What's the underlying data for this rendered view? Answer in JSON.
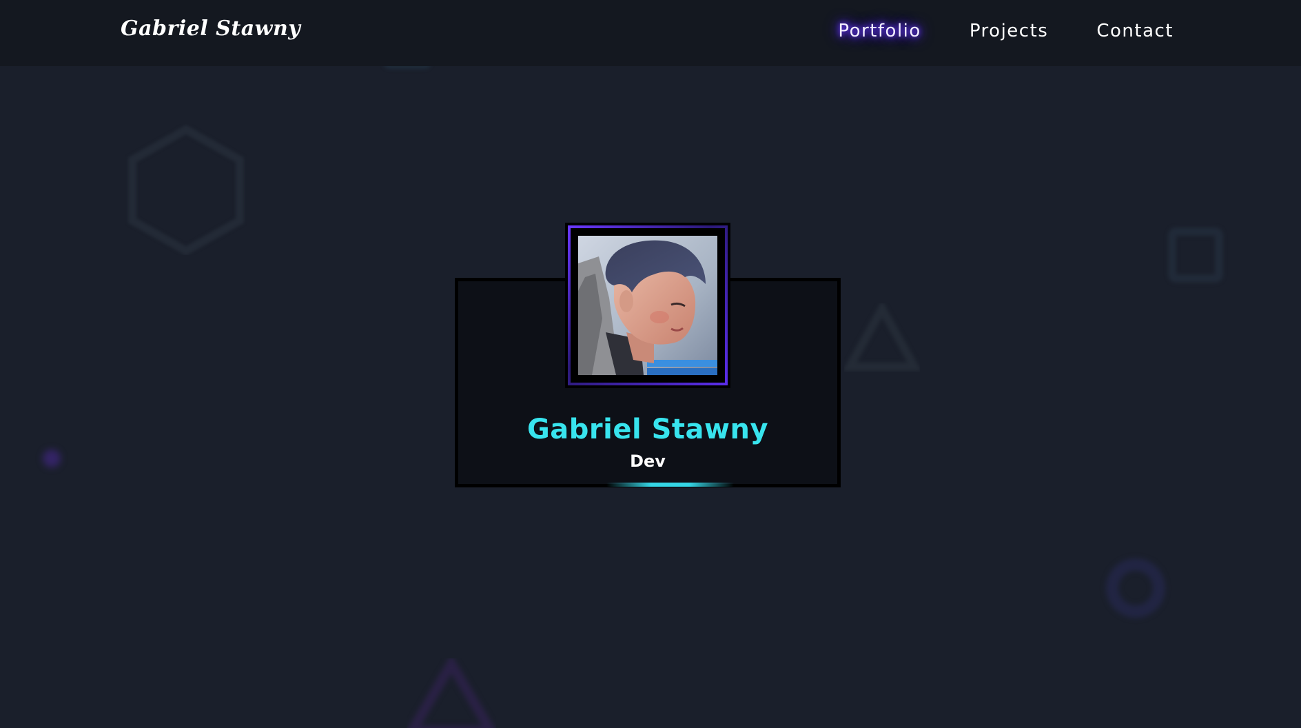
{
  "header": {
    "brand": "Gabriel Stawny",
    "nav": [
      {
        "label": "Portfolio",
        "active": true
      },
      {
        "label": "Projects",
        "active": false
      },
      {
        "label": "Contact",
        "active": false
      }
    ]
  },
  "profile": {
    "name": "Gabriel Stawny",
    "role": "Dev"
  },
  "colors": {
    "background": "#1a1f2b",
    "header_background": "#141820",
    "card_background": "#0d1017",
    "accent_cyan": "#38e4ee",
    "accent_purple": "#6a38ff"
  },
  "icons": {
    "decorations": [
      "hexagon-outline",
      "square-outline",
      "triangle-outline",
      "ring-outline",
      "dot"
    ]
  }
}
